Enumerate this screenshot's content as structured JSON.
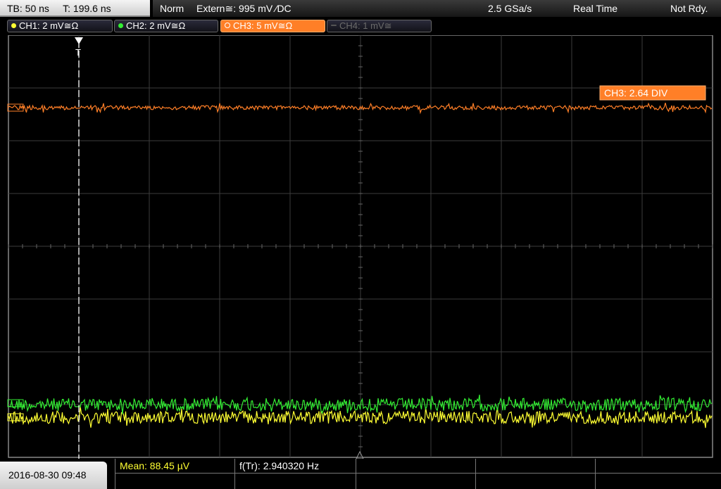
{
  "header": {
    "timebase": "TB: 50 ns",
    "trigger_time": "T: 199.6 ns",
    "trigger_mode": "Norm",
    "trigger_source": "Extern≅: 995 mV ⁄DC",
    "sample_rate": "2.5 GSa/s",
    "acq_mode": "Real Time",
    "status": "Not Rdy."
  },
  "channels": [
    {
      "label": "CH1: 2 mV≅Ω",
      "color": "#ffff33",
      "state": "on"
    },
    {
      "label": "CH2: 2 mV≅Ω",
      "color": "#33ee33",
      "state": "on"
    },
    {
      "label": "CH3: 5 mV≅Ω",
      "color": "#ff7f27",
      "state": "selected"
    },
    {
      "label": "CH4: 1 mV≅",
      "color": "#777777",
      "state": "off"
    }
  ],
  "display": {
    "ch3_offset_label": "CH3: 2.64 DIV",
    "ref_marker_label": "CH3",
    "grid": "10x8 divisions"
  },
  "measurements": {
    "mean": "Mean: 88.45 µV",
    "freq": "f(Tr): 2.940320 Hz"
  },
  "footer": {
    "datetime": "2016-08-30 09:48"
  },
  "colors": {
    "ch1": "#ffff33",
    "ch2": "#33ee33",
    "ch3": "#ff7f27",
    "grid": "#555555"
  }
}
